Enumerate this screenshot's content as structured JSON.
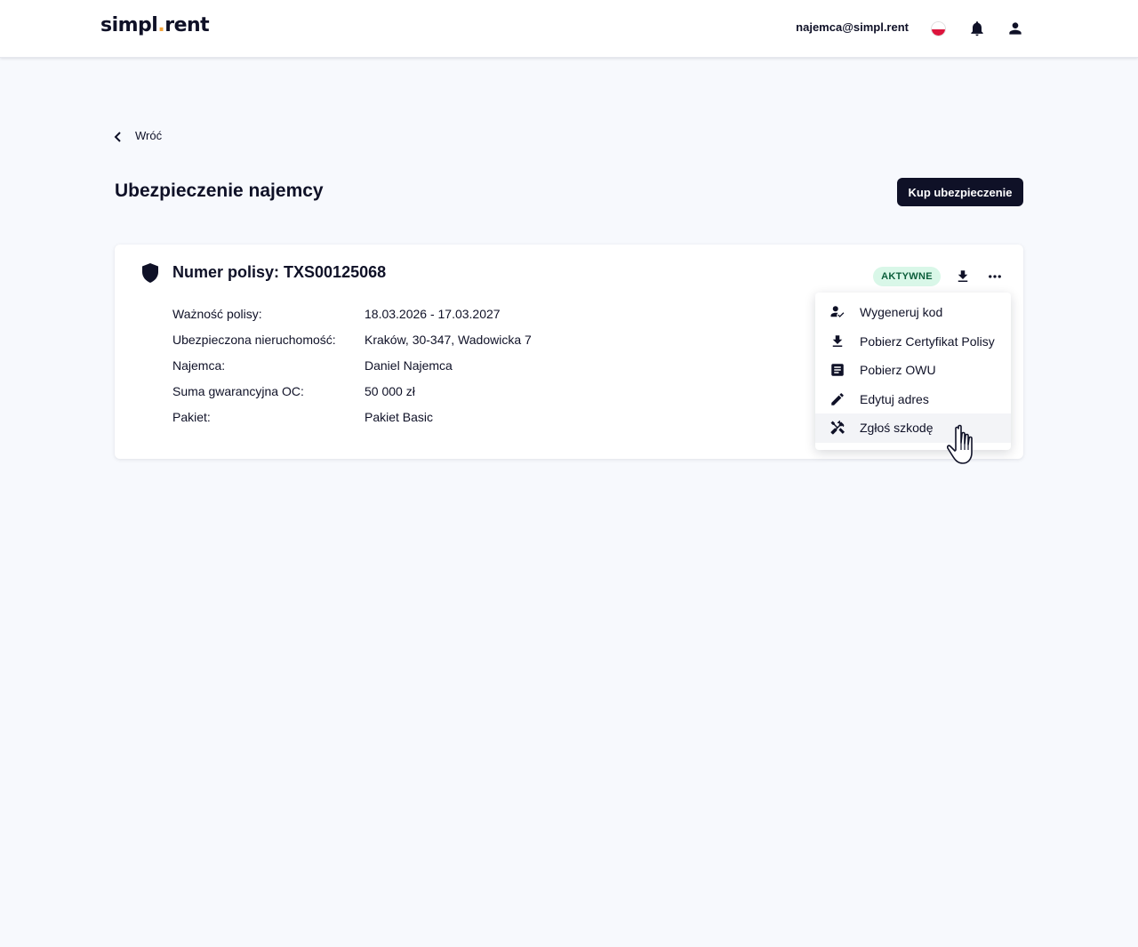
{
  "header": {
    "logo_part1": "simpl",
    "logo_dot": ".",
    "logo_part2": "rent",
    "user_email": "najemca@simpl.rent",
    "icons": [
      "poland-flag-icon",
      "bell-icon",
      "person-icon"
    ]
  },
  "nav": {
    "back_label": "Wróć"
  },
  "page": {
    "title": "Ubezpieczenie najemcy",
    "buy_button": "Kup ubezpieczenie"
  },
  "policy": {
    "title": "Numer polisy: TXS00125068",
    "status": "AKTYWNE",
    "details": [
      {
        "label": "Ważność polisy:",
        "value": "18.03.2026 - 17.03.2027"
      },
      {
        "label": "Ubezpieczona nieruchomość:",
        "value": "Kraków, 30-347, Wadowicka 7"
      },
      {
        "label": "Najemca:",
        "value": "Daniel Najemca"
      },
      {
        "label": "Suma gwarancyjna OC:",
        "value": "50 000 zł"
      },
      {
        "label": "Pakiet:",
        "value": "Pakiet Basic"
      }
    ]
  },
  "menu": {
    "items": [
      {
        "label": "Wygeneruj kod",
        "icon": "person-check-icon"
      },
      {
        "label": "Pobierz Certyfikat Polisy",
        "icon": "download-icon"
      },
      {
        "label": "Pobierz OWU",
        "icon": "document-icon"
      },
      {
        "label": "Edytuj adres",
        "icon": "pencil-icon"
      },
      {
        "label": "Zgłoś szkodę",
        "icon": "tools-icon"
      }
    ],
    "hovered_index": 4
  },
  "colors": {
    "primary": "#0f1127",
    "background": "#f7f9fd",
    "logo_dot": "#f2a33a",
    "status_bg": "#d9f7e8",
    "status_text": "#0b5e3b"
  }
}
